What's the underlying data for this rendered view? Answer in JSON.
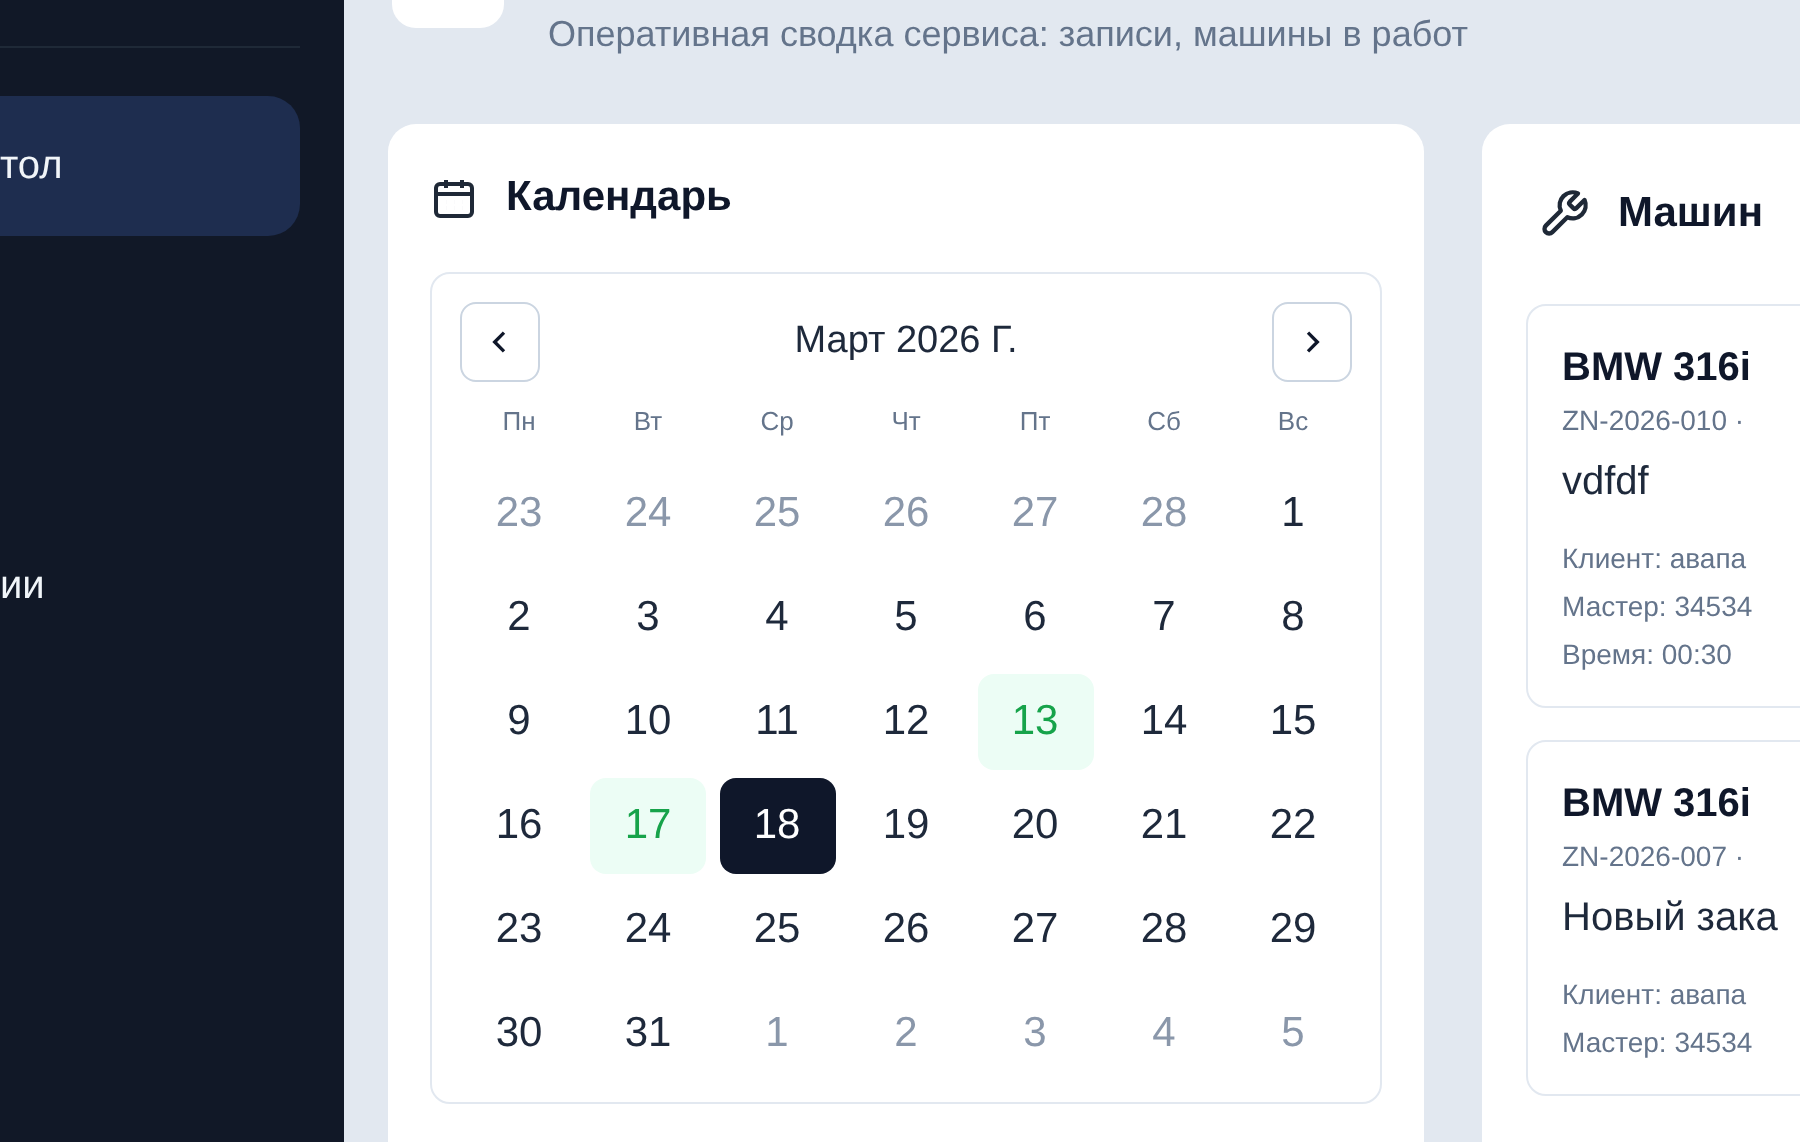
{
  "sidebar": {
    "items": [
      {
        "label": "тол",
        "selected": true
      },
      {
        "label": "ии",
        "selected": false
      }
    ]
  },
  "header": {
    "subtitle": "Оперативная сводка сервиса: записи, машины в работ"
  },
  "calendar": {
    "title": "Календарь",
    "month": "Март 2026 Г.",
    "weekdays": [
      "Пн",
      "Вт",
      "Ср",
      "Чт",
      "Пт",
      "Сб",
      "Вс"
    ],
    "days": [
      {
        "label": "23",
        "muted": true,
        "has_event": false,
        "selected": false
      },
      {
        "label": "24",
        "muted": true,
        "has_event": false,
        "selected": false
      },
      {
        "label": "25",
        "muted": true,
        "has_event": false,
        "selected": false
      },
      {
        "label": "26",
        "muted": true,
        "has_event": false,
        "selected": false
      },
      {
        "label": "27",
        "muted": true,
        "has_event": false,
        "selected": false
      },
      {
        "label": "28",
        "muted": true,
        "has_event": false,
        "selected": false
      },
      {
        "label": "1",
        "muted": false,
        "has_event": false,
        "selected": false
      },
      {
        "label": "2",
        "muted": false,
        "has_event": false,
        "selected": false
      },
      {
        "label": "3",
        "muted": false,
        "has_event": false,
        "selected": false
      },
      {
        "label": "4",
        "muted": false,
        "has_event": false,
        "selected": false
      },
      {
        "label": "5",
        "muted": false,
        "has_event": false,
        "selected": false
      },
      {
        "label": "6",
        "muted": false,
        "has_event": false,
        "selected": false
      },
      {
        "label": "7",
        "muted": false,
        "has_event": false,
        "selected": false
      },
      {
        "label": "8",
        "muted": false,
        "has_event": false,
        "selected": false
      },
      {
        "label": "9",
        "muted": false,
        "has_event": false,
        "selected": false
      },
      {
        "label": "10",
        "muted": false,
        "has_event": false,
        "selected": false
      },
      {
        "label": "11",
        "muted": false,
        "has_event": false,
        "selected": false
      },
      {
        "label": "12",
        "muted": false,
        "has_event": false,
        "selected": false
      },
      {
        "label": "13",
        "muted": false,
        "has_event": true,
        "selected": false
      },
      {
        "label": "14",
        "muted": false,
        "has_event": false,
        "selected": false
      },
      {
        "label": "15",
        "muted": false,
        "has_event": false,
        "selected": false
      },
      {
        "label": "16",
        "muted": false,
        "has_event": false,
        "selected": false
      },
      {
        "label": "17",
        "muted": false,
        "has_event": true,
        "selected": false
      },
      {
        "label": "18",
        "muted": false,
        "has_event": false,
        "selected": true
      },
      {
        "label": "19",
        "muted": false,
        "has_event": false,
        "selected": false
      },
      {
        "label": "20",
        "muted": false,
        "has_event": false,
        "selected": false
      },
      {
        "label": "21",
        "muted": false,
        "has_event": false,
        "selected": false
      },
      {
        "label": "22",
        "muted": false,
        "has_event": false,
        "selected": false
      },
      {
        "label": "23",
        "muted": false,
        "has_event": false,
        "selected": false
      },
      {
        "label": "24",
        "muted": false,
        "has_event": false,
        "selected": false
      },
      {
        "label": "25",
        "muted": false,
        "has_event": false,
        "selected": false
      },
      {
        "label": "26",
        "muted": false,
        "has_event": false,
        "selected": false
      },
      {
        "label": "27",
        "muted": false,
        "has_event": false,
        "selected": false
      },
      {
        "label": "28",
        "muted": false,
        "has_event": false,
        "selected": false
      },
      {
        "label": "29",
        "muted": false,
        "has_event": false,
        "selected": false
      },
      {
        "label": "30",
        "muted": false,
        "has_event": false,
        "selected": false
      },
      {
        "label": "31",
        "muted": false,
        "has_event": false,
        "selected": false
      },
      {
        "label": "1",
        "muted": true,
        "has_event": false,
        "selected": false
      },
      {
        "label": "2",
        "muted": true,
        "has_event": false,
        "selected": false
      },
      {
        "label": "3",
        "muted": true,
        "has_event": false,
        "selected": false
      },
      {
        "label": "4",
        "muted": true,
        "has_event": false,
        "selected": false
      },
      {
        "label": "5",
        "muted": true,
        "has_event": false,
        "selected": false
      }
    ]
  },
  "cars": {
    "title": "Машин",
    "items": [
      {
        "title": "BMW 316i",
        "code": "ZN-2026-010 ·",
        "description": "vdfdf",
        "meta": [
          "Клиент: авапа",
          "Мастер: 34534",
          "Время: 00:30"
        ]
      },
      {
        "title": "BMW 316i",
        "code": "ZN-2026-007 ·",
        "description": "Новый зака",
        "meta": [
          "Клиент: авапа",
          "Мастер: 34534"
        ]
      }
    ]
  }
}
